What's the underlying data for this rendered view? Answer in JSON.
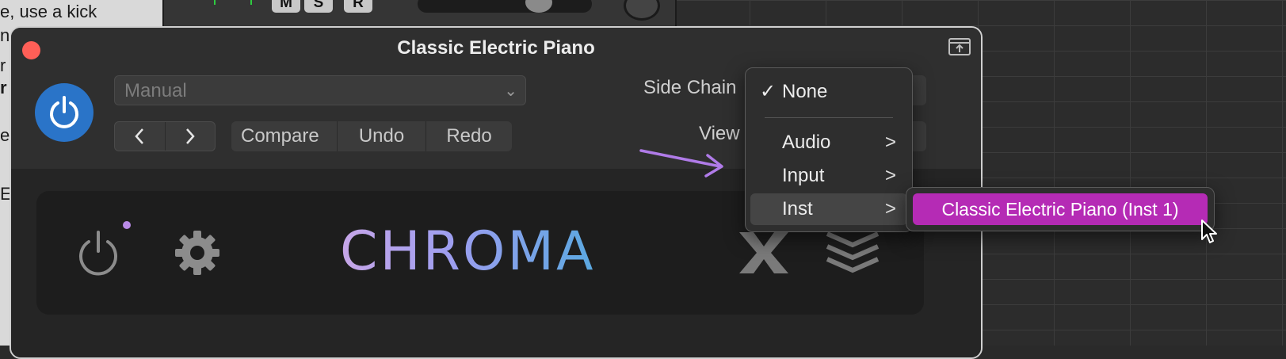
{
  "background": {
    "left_text_lines": [
      "e, use a kick",
      "n",
      "r",
      "r",
      "e",
      "E"
    ],
    "track_buttons": [
      "M",
      "S",
      "R"
    ]
  },
  "window": {
    "title": "Classic Electric Piano",
    "preset": {
      "value": "Manual"
    },
    "nav": {
      "prev": "<",
      "next": ">"
    },
    "edit": {
      "compare": "Compare",
      "undo": "Undo",
      "redo": "Redo"
    },
    "side_chain_label": "Side Chain",
    "view_label": "View"
  },
  "plugin": {
    "logo_text": "CHROMA",
    "logo_gradient": [
      "#c7a6e8",
      "#9c9ef0",
      "#5aa8e0"
    ]
  },
  "side_chain_menu": {
    "items": [
      {
        "label": "None",
        "checked": true,
        "check": "✓"
      },
      {
        "label": "Audio",
        "submenu": ">"
      },
      {
        "label": "Input",
        "submenu": ">"
      },
      {
        "label": "Inst",
        "submenu": ">",
        "highlighted": true
      }
    ],
    "submenu_item": {
      "label": "Classic Electric Piano (Inst 1)",
      "highlight_color": "#b52bb5"
    }
  },
  "colors": {
    "power_button": "#2a74c8",
    "close_button": "#ff5f57",
    "annotation_arrow": "#b07be8"
  }
}
